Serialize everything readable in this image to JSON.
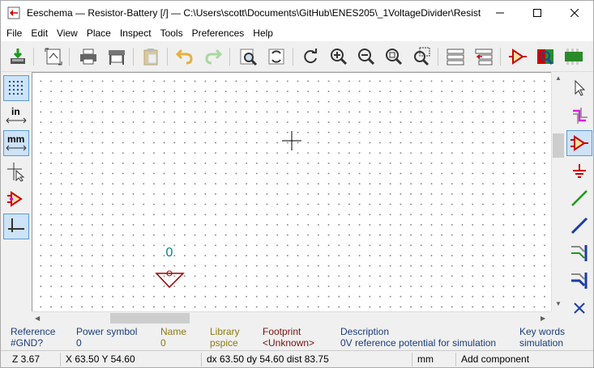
{
  "window": {
    "title": "Eeschema — Resistor-Battery [/] — C:\\Users\\scott\\Documents\\GitHub\\ENES205\\_1VoltageDivider\\Resist..."
  },
  "menu": {
    "items": [
      {
        "label": "File"
      },
      {
        "label": "Edit"
      },
      {
        "label": "View"
      },
      {
        "label": "Place"
      },
      {
        "label": "Inspect"
      },
      {
        "label": "Tools"
      },
      {
        "label": "Preferences"
      },
      {
        "label": "Help"
      }
    ]
  },
  "left_toolbar": {
    "in_label": "in",
    "mm_label": "mm"
  },
  "canvas": {
    "symbol_value": "0"
  },
  "info_panel": {
    "columns": [
      {
        "header": "Reference",
        "value": "#GND?",
        "color": "#1a3d7c"
      },
      {
        "header": "Power symbol",
        "value": "0",
        "color": "#1a3d7c"
      },
      {
        "header": "Name",
        "value": "0",
        "color": "#8c7b10"
      },
      {
        "header": "Library",
        "value": "pspice",
        "color": "#8c7b10"
      },
      {
        "header": "Footprint",
        "value": "<Unknown>",
        "color": "#7a1010"
      },
      {
        "header": "Description",
        "value": "0V reference potential for simulation",
        "color": "#1a3d7c"
      },
      {
        "header": "Key words",
        "value": "simulation",
        "color": "#1a3d7c"
      }
    ]
  },
  "status_bar": {
    "zoom": "Z 3.67",
    "cursor": "X 63.50  Y 54.60",
    "delta": "dx 63.50  dy 54.60  dist 83.75",
    "units": "mm",
    "mode": "Add component"
  },
  "colors": {
    "accent": "#5b9bd5",
    "symbol_text": "#008080",
    "ground_symbol": "#a00000"
  }
}
